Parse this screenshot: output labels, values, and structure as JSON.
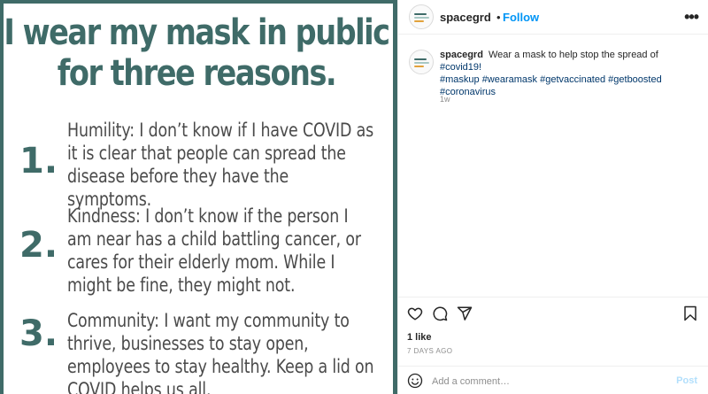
{
  "post_image": {
    "headline": "I wear my mask in public for three reasons.",
    "reasons": [
      {
        "number": "1.",
        "text": "Humility: I don’t know if I have COVID as it is clear that people can spread the disease before they have the symptoms."
      },
      {
        "number": "2.",
        "text": "Kindness: I don’t know if the person I am near has a child battling cancer, or cares for their elderly mom. While I might be fine, they might not."
      },
      {
        "number": "3.",
        "text": "Community: I want my community to thrive, businesses to stay open, employees to stay healthy. Keep a lid on COVID helps us all."
      }
    ],
    "colors": {
      "accent": "#3f6b68",
      "body_text": "#4a4a4a"
    }
  },
  "header": {
    "username": "spacegrd",
    "separator": "•",
    "follow_label": "Follow",
    "more_icon": "more-options-icon",
    "more_label": "•••"
  },
  "caption": {
    "username": "spacegrd",
    "text": "Wear a mask to help stop the spread of",
    "hashtags_line1": "#covid19!",
    "hashtags_line2": "#maskup #wearamask #getvaccinated #getboosted",
    "hashtags_line3": "#coronavirus",
    "age": "1w"
  },
  "actions": {
    "icons": [
      "heart-icon",
      "comment-icon",
      "share-icon",
      "bookmark-icon"
    ],
    "likes": "1 like",
    "date": "7 DAYS AGO"
  },
  "comment_box": {
    "emoji_icon": "emoji-icon",
    "placeholder": "Add a comment…",
    "post_label": "Post"
  },
  "colors": {
    "link_blue": "#0095f6",
    "hashtag": "#00376b",
    "muted": "#8e8e8e",
    "post_disabled": "#b2dffc"
  }
}
